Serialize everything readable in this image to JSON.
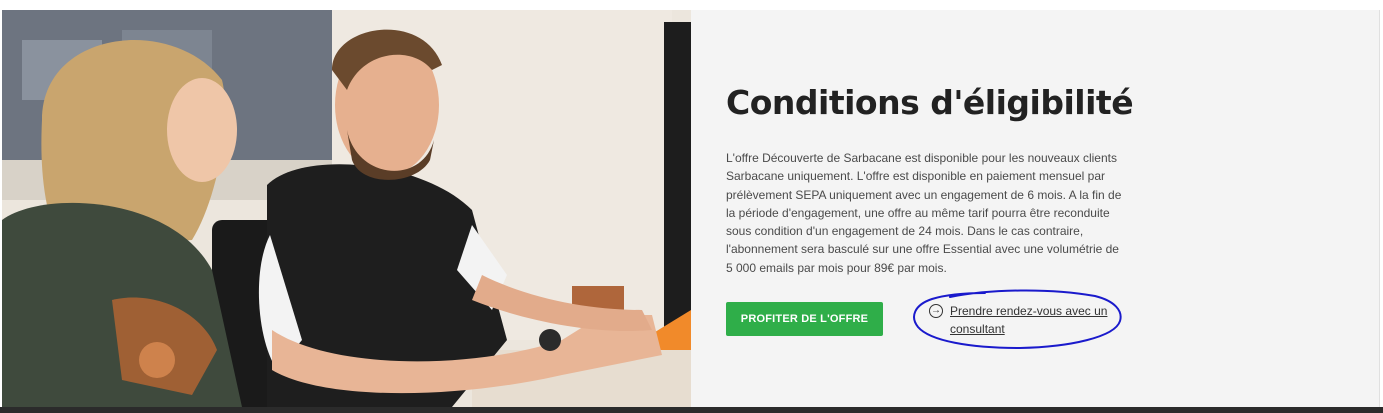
{
  "hero": {
    "image_alt": "",
    "accent_color": "#f18a2a"
  },
  "section": {
    "title": "Conditions d'éligibilité",
    "body": "L'offre Découverte de Sarbacane est disponible pour les nouveaux clients Sarbacane uniquement. L'offre est disponible en paiement mensuel par prélèvement SEPA uniquement avec un engagement de 6 mois. A la fin de la période d'engagement, une offre au même tarif pourra être reconduite sous condition d'un engagement de 24 mois. Dans le cas contraire, l'abonnement sera basculé sur une offre Essential avec une volumétrie de 5 000 emails par mois pour 89€ par mois.",
    "cta_label": "PROFITER DE L'OFFRE",
    "cta_color": "#2fae49",
    "link_label": "Prendre rendez-vous avec un consultant",
    "link_icon": "arrow-right-circle-icon",
    "annotation_color": "#1a1acc"
  }
}
